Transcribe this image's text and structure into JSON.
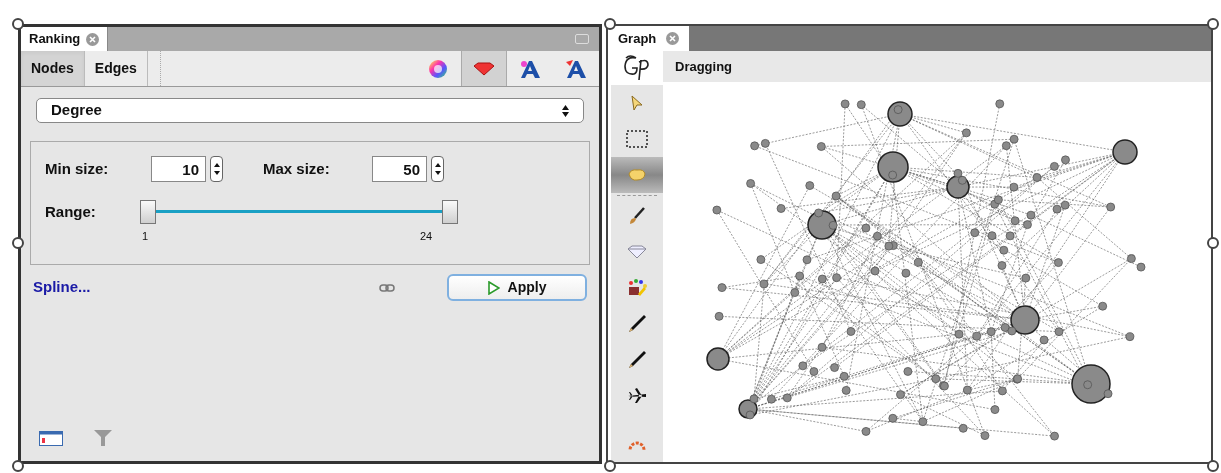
{
  "ranking_panel": {
    "tab": {
      "label": "Ranking"
    },
    "element_tabs": [
      {
        "label": "Nodes",
        "selected": true
      },
      {
        "label": "Edges",
        "selected": false
      }
    ],
    "transform_buttons": [
      {
        "kind": "color",
        "selected": false
      },
      {
        "kind": "size",
        "selected": true
      },
      {
        "kind": "label_color",
        "selected": false
      },
      {
        "kind": "label_size",
        "selected": false
      }
    ],
    "attribute_select": {
      "value": "Degree"
    },
    "min_size": {
      "label": "Min size:",
      "value": "10"
    },
    "max_size": {
      "label": "Max size:",
      "value": "50"
    },
    "range": {
      "label": "Range:",
      "min_label": "1",
      "max_label": "24",
      "thumbs": [
        {
          "level": 0
        },
        {
          "level": 1
        }
      ]
    },
    "spline_link": "Spline...",
    "apply_button": "Apply"
  },
  "graph_panel": {
    "tab": {
      "label": "Graph"
    },
    "mode": "Dragging",
    "tools": [
      {
        "kind": "pointer",
        "selected": false
      },
      {
        "kind": "rectangle",
        "selected": false
      },
      {
        "kind": "hand",
        "selected": true
      },
      {
        "kind": "separator",
        "selected": false
      },
      {
        "kind": "brush",
        "selected": false
      },
      {
        "kind": "diamond",
        "selected": false
      },
      {
        "kind": "palette",
        "selected": false
      },
      {
        "kind": "pencil",
        "selected": false
      },
      {
        "kind": "pencil",
        "selected": false
      },
      {
        "kind": "plane",
        "selected": false
      },
      {
        "kind": "gear",
        "selected": false
      }
    ]
  }
}
